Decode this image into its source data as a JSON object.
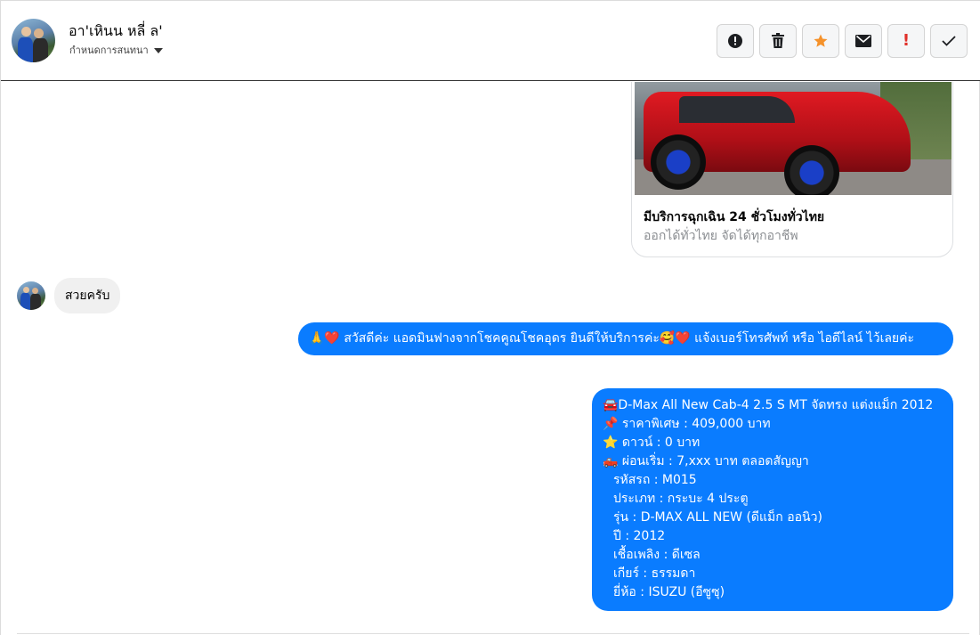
{
  "header": {
    "contact_name": "อา'เหินน หลี่ ล'",
    "assign_label": "กำหนดการสนทนา"
  },
  "actions": [
    {
      "name": "alert-circle-icon",
      "label": "!"
    },
    {
      "name": "trash-icon"
    },
    {
      "name": "star-icon"
    },
    {
      "name": "envelope-icon"
    },
    {
      "name": "exclamation-icon",
      "label": "!"
    },
    {
      "name": "check-icon"
    }
  ],
  "colors": {
    "outgoing_bubble": "#0a7cff",
    "incoming_bubble": "#f0f0f0",
    "star": "#f5922b",
    "exclamation": "#e0302a"
  },
  "card": {
    "title": "มีบริการฉุกเฉิน 24 ชั่วโมงทั่วไทย",
    "subtitle": "ออกได้ทั่วไทย จัดได้ทุกอาชีพ"
  },
  "messages": {
    "incoming_1": "สวยครับ",
    "outgoing_1": "🙏❤️ สวัสดีค่ะ แอดมินฟางจากโชคคูณโชคอุดร ยินดีให้บริการค่ะ🥰❤️ แจ้งเบอร์โทรศัพท์ หรือ ไอดีไลน์  ไว้เลยค่ะ",
    "outgoing_2": [
      "🚘D-Max All New Cab-4 2.5 S MT จัดทรง แต่งแม็ก 2012",
      "📌 ราคาพิเศษ : 409,000 บาท",
      "⭐ ดาวน์ : 0 บาท",
      "🛻 ผ่อนเริ่ม : 7,xxx บาท ตลอดสัญญา",
      "รหัสรถ : M015",
      "ประเภท : กระบะ 4 ประตู",
      "รุ่น : D-MAX ALL NEW (ดีแม็ก ออนิว)",
      "ปี : 2012",
      "เชื้อเพลิง : ดีเซล",
      "เกียร์ : ธรรมดา",
      "ยี่ห้อ : ISUZU (อีซูซุ)"
    ]
  }
}
